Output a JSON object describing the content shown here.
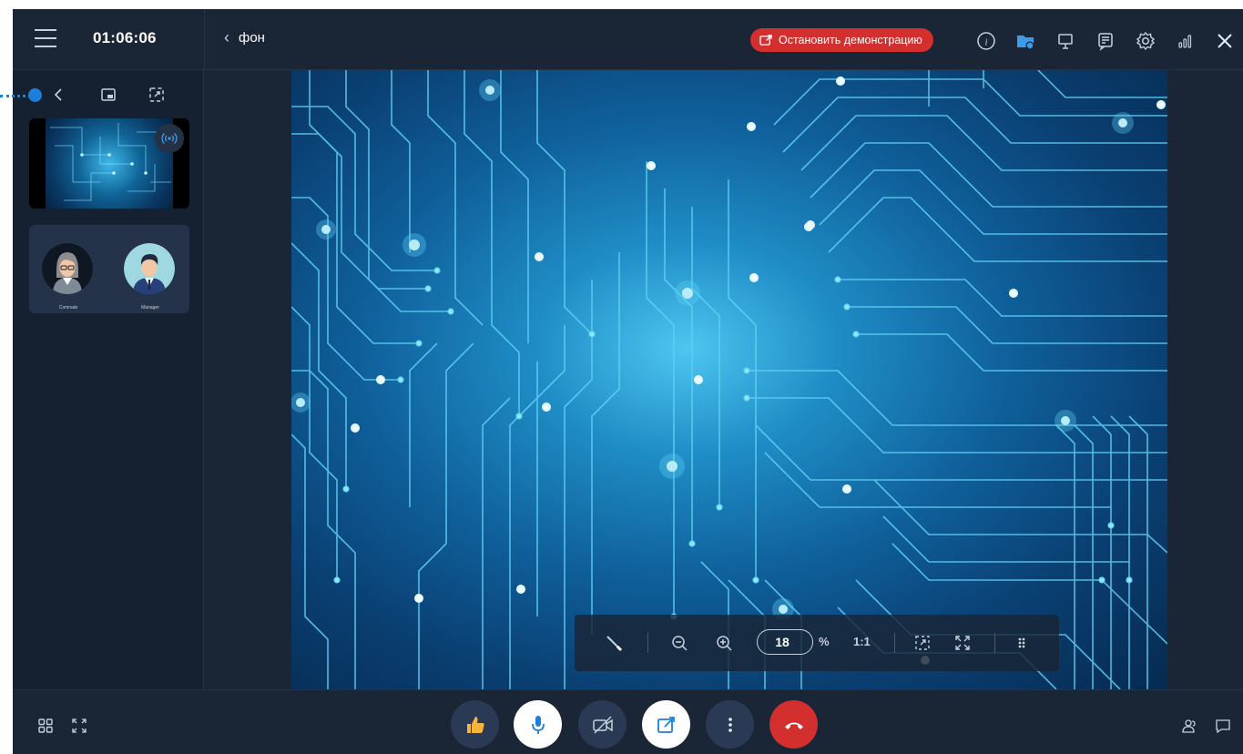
{
  "header": {
    "timer": "01:06:06",
    "back_title": "фон",
    "stop_demo_label": "Остановить демонстрацию"
  },
  "left_panel": {
    "participants": [
      {
        "name": "Comrade"
      },
      {
        "name": "Manager"
      }
    ]
  },
  "zoom_toolbar": {
    "zoom_value": "18",
    "percent_sign": "%",
    "actual_size_label": "1:1"
  },
  "colors": {
    "accent": "#1e7fd9",
    "stop_red": "#d32f2f",
    "hangup_red": "#d32f2f",
    "panel_bg": "#1a2535"
  },
  "icons": {
    "menu": "hamburger-icon",
    "info": "info-icon",
    "files": "folder-icon",
    "board": "whiteboard-icon",
    "notes": "notes-icon",
    "settings": "gear-icon",
    "signal": "signal-bars-icon",
    "close": "close-icon",
    "like": "thumbs-up-icon",
    "mic": "microphone-icon",
    "camera_off": "camera-off-icon",
    "share": "share-screen-icon",
    "more": "more-vertical-icon",
    "hangup": "hangup-icon"
  }
}
